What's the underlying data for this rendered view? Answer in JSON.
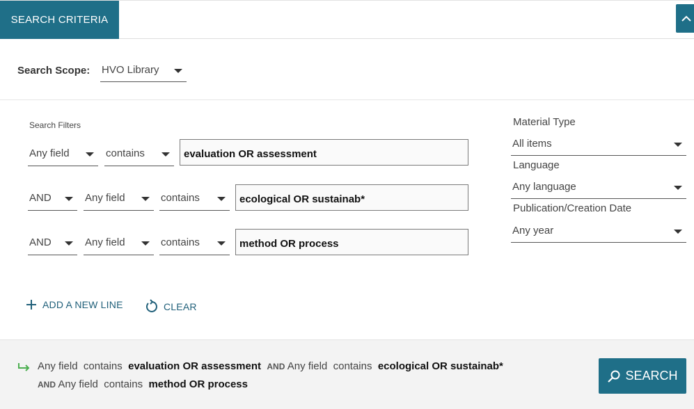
{
  "header": {
    "tab_label": "SEARCH CRITERIA"
  },
  "scope": {
    "label": "Search Scope:",
    "value": "HVO Library"
  },
  "filters": {
    "label": "Search Filters",
    "lines": [
      {
        "operator": "",
        "field": "Any field",
        "condition": "contains",
        "value": "evaluation OR assessment"
      },
      {
        "operator": "AND",
        "field": "Any field",
        "condition": "contains",
        "value": "ecological OR sustainab*"
      },
      {
        "operator": "AND",
        "field": "Any field",
        "condition": "contains",
        "value": "method OR process"
      }
    ]
  },
  "side": {
    "material_type_label": "Material Type",
    "material_type_value": "All items",
    "language_label": "Language",
    "language_value": "Any language",
    "date_label": "Publication/Creation Date",
    "date_value": "Any year"
  },
  "actions": {
    "add_line": "ADD A NEW LINE",
    "clear": "CLEAR"
  },
  "summary": {
    "line1_field": "Any field",
    "line1_cond": "contains",
    "line1_value": "evaluation OR assessment",
    "line2_op": "AND",
    "line2_field": "Any field",
    "line2_cond": "contains",
    "line2_value": "ecological OR sustainab*",
    "line3_op": "AND",
    "line3_field": "Any field",
    "line3_cond": "contains",
    "line3_value": "method OR process"
  },
  "search_button": "SEARCH",
  "colors": {
    "accent": "#1f6f88",
    "link": "#1f5f79",
    "arrow_green": "#4caf50"
  }
}
